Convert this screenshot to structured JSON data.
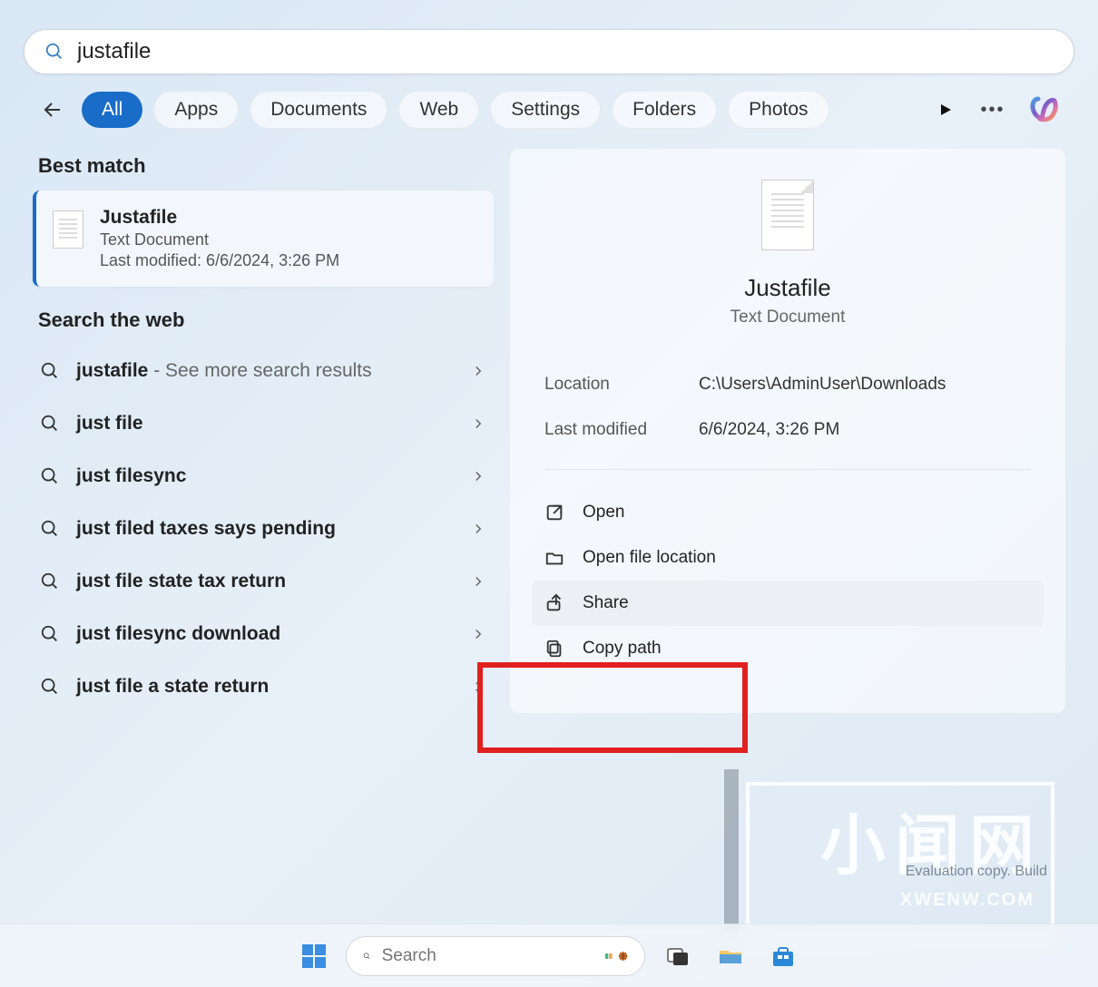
{
  "search": {
    "query": "justafile"
  },
  "filters": {
    "all": "All",
    "apps": "Apps",
    "documents": "Documents",
    "web": "Web",
    "settings": "Settings",
    "folders": "Folders",
    "photos": "Photos"
  },
  "best_match_header": "Best match",
  "best_match": {
    "title": "Justafile",
    "type": "Text Document",
    "modified": "Last modified: 6/6/2024, 3:26 PM"
  },
  "web_header": "Search the web",
  "web_results": [
    {
      "text": "justafile",
      "suffix": " - See more search results"
    },
    {
      "text": "just file",
      "suffix": ""
    },
    {
      "text": "just filesync",
      "suffix": ""
    },
    {
      "text": "just filed taxes says pending",
      "suffix": ""
    },
    {
      "text": "just file state tax return",
      "suffix": ""
    },
    {
      "text": "just filesync download",
      "suffix": ""
    },
    {
      "text": "just file a state return",
      "suffix": ""
    }
  ],
  "preview": {
    "title": "Justafile",
    "type": "Text Document",
    "location_label": "Location",
    "location_value": "C:\\Users\\AdminUser\\Downloads",
    "modified_label": "Last modified",
    "modified_value": "6/6/2024, 3:26 PM"
  },
  "actions": {
    "open": "Open",
    "open_location": "Open file location",
    "share": "Share",
    "copy_path": "Copy path"
  },
  "taskbar": {
    "search_placeholder": "Search"
  },
  "watermark": {
    "big": "小闻网",
    "url": "XWENW.COM",
    "eval": "Evaluation copy. Build"
  }
}
